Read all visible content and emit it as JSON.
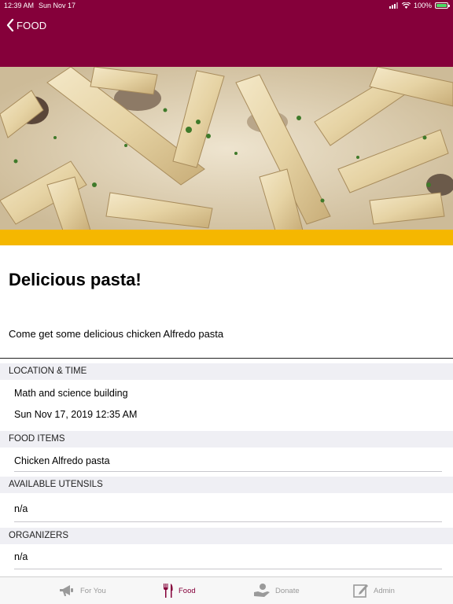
{
  "status_bar": {
    "time": "12:39 AM",
    "date": "Sun Nov 17",
    "battery": "100%"
  },
  "nav": {
    "back_label": "FOOD"
  },
  "event": {
    "title": "Delicious pasta!",
    "description": "Come get some delicious chicken Alfredo pasta"
  },
  "sections": {
    "location_time": {
      "header": "LOCATION & TIME",
      "location": "Math and science building",
      "datetime": "Sun Nov 17, 2019 12:35 AM"
    },
    "food_items": {
      "header": "FOOD ITEMS",
      "items": [
        "Chicken Alfredo pasta"
      ]
    },
    "utensils": {
      "header": "AVAILABLE UTENSILS",
      "value": "n/a"
    },
    "organizers": {
      "header": "ORGANIZERS",
      "value": "n/a"
    }
  },
  "tabs": [
    {
      "label": "For You",
      "icon": "megaphone-icon",
      "active": false
    },
    {
      "label": "Food",
      "icon": "fork-knife-icon",
      "active": true
    },
    {
      "label": "Donate",
      "icon": "donate-hand-icon",
      "active": false
    },
    {
      "label": "Admin",
      "icon": "edit-icon",
      "active": false
    }
  ],
  "colors": {
    "header": "#85003a",
    "band": "#f5b700",
    "active_tab": "#85003a",
    "inactive_tab": "#999999"
  }
}
